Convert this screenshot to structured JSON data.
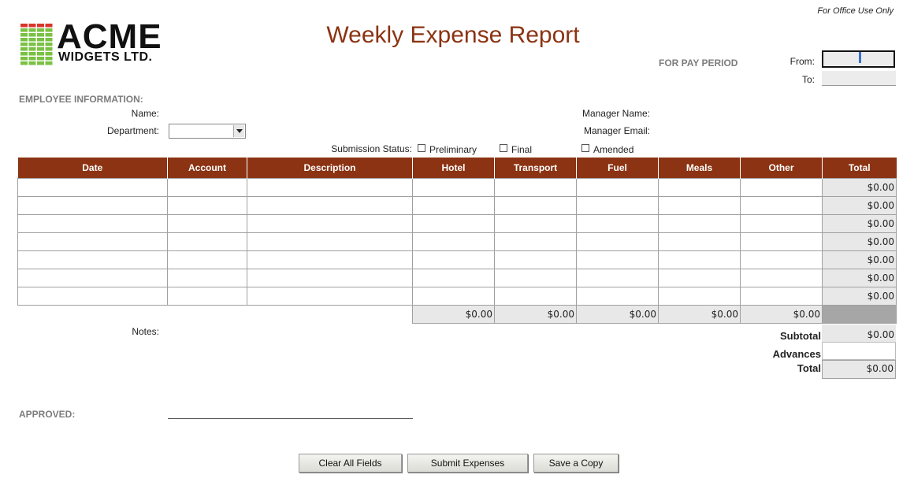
{
  "logo": {
    "line1": "ACME",
    "line2": "WIDGETS LTD.",
    "bar_colors": [
      "#d9342b",
      "#7ac143"
    ]
  },
  "header": {
    "title": "Weekly Expense Report",
    "office_use": "For Office Use Only",
    "pay_period_label": "FOR PAY PERIOD",
    "from_label": "From:",
    "to_label": "To:",
    "from_value": "",
    "to_value": ""
  },
  "employee": {
    "section_label": "EMPLOYEE INFORMATION:",
    "name_label": "Name:",
    "department_label": "Department:",
    "department_value": "",
    "manager_name_label": "Manager Name:",
    "manager_email_label": "Manager Email:"
  },
  "status": {
    "label": "Submission Status:",
    "options": [
      {
        "label": "Preliminary",
        "checked": false
      },
      {
        "label": "Final",
        "checked": false
      },
      {
        "label": "Amended",
        "checked": false
      }
    ]
  },
  "table": {
    "columns": [
      "Date",
      "Account",
      "Description",
      "Hotel",
      "Transport",
      "Fuel",
      "Meals",
      "Other",
      "Total"
    ],
    "rows": [
      {
        "total": "$0.00"
      },
      {
        "total": "$0.00"
      },
      {
        "total": "$0.00"
      },
      {
        "total": "$0.00"
      },
      {
        "total": "$0.00"
      },
      {
        "total": "$0.00"
      },
      {
        "total": "$0.00"
      }
    ],
    "column_totals": [
      "$0.00",
      "$0.00",
      "$0.00",
      "$0.00",
      "$0.00"
    ]
  },
  "summary": {
    "notes_label": "Notes:",
    "subtotal_label": "Subtotal",
    "subtotal_value": "$0.00",
    "advances_label": "Advances",
    "advances_value": "",
    "total_label": "Total",
    "total_value": "$0.00"
  },
  "approved_label": "APPROVED:",
  "buttons": {
    "clear": "Clear All Fields",
    "submit": "Submit Expenses",
    "save": "Save a Copy"
  },
  "colors": {
    "accent": "#8b3312",
    "label_gray": "#7c7c7c",
    "field_gray": "#e8e8e8"
  }
}
